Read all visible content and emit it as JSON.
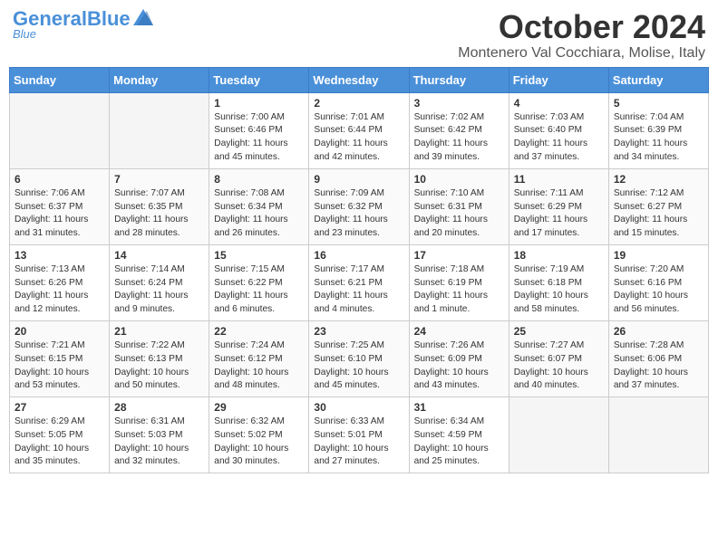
{
  "header": {
    "logo_general": "General",
    "logo_blue": "Blue",
    "month": "October 2024",
    "location": "Montenero Val Cocchiara, Molise, Italy"
  },
  "days_of_week": [
    "Sunday",
    "Monday",
    "Tuesday",
    "Wednesday",
    "Thursday",
    "Friday",
    "Saturday"
  ],
  "weeks": [
    [
      {
        "day": "",
        "info": ""
      },
      {
        "day": "",
        "info": ""
      },
      {
        "day": "1",
        "info": "Sunrise: 7:00 AM\nSunset: 6:46 PM\nDaylight: 11 hours and 45 minutes."
      },
      {
        "day": "2",
        "info": "Sunrise: 7:01 AM\nSunset: 6:44 PM\nDaylight: 11 hours and 42 minutes."
      },
      {
        "day": "3",
        "info": "Sunrise: 7:02 AM\nSunset: 6:42 PM\nDaylight: 11 hours and 39 minutes."
      },
      {
        "day": "4",
        "info": "Sunrise: 7:03 AM\nSunset: 6:40 PM\nDaylight: 11 hours and 37 minutes."
      },
      {
        "day": "5",
        "info": "Sunrise: 7:04 AM\nSunset: 6:39 PM\nDaylight: 11 hours and 34 minutes."
      }
    ],
    [
      {
        "day": "6",
        "info": "Sunrise: 7:06 AM\nSunset: 6:37 PM\nDaylight: 11 hours and 31 minutes."
      },
      {
        "day": "7",
        "info": "Sunrise: 7:07 AM\nSunset: 6:35 PM\nDaylight: 11 hours and 28 minutes."
      },
      {
        "day": "8",
        "info": "Sunrise: 7:08 AM\nSunset: 6:34 PM\nDaylight: 11 hours and 26 minutes."
      },
      {
        "day": "9",
        "info": "Sunrise: 7:09 AM\nSunset: 6:32 PM\nDaylight: 11 hours and 23 minutes."
      },
      {
        "day": "10",
        "info": "Sunrise: 7:10 AM\nSunset: 6:31 PM\nDaylight: 11 hours and 20 minutes."
      },
      {
        "day": "11",
        "info": "Sunrise: 7:11 AM\nSunset: 6:29 PM\nDaylight: 11 hours and 17 minutes."
      },
      {
        "day": "12",
        "info": "Sunrise: 7:12 AM\nSunset: 6:27 PM\nDaylight: 11 hours and 15 minutes."
      }
    ],
    [
      {
        "day": "13",
        "info": "Sunrise: 7:13 AM\nSunset: 6:26 PM\nDaylight: 11 hours and 12 minutes."
      },
      {
        "day": "14",
        "info": "Sunrise: 7:14 AM\nSunset: 6:24 PM\nDaylight: 11 hours and 9 minutes."
      },
      {
        "day": "15",
        "info": "Sunrise: 7:15 AM\nSunset: 6:22 PM\nDaylight: 11 hours and 6 minutes."
      },
      {
        "day": "16",
        "info": "Sunrise: 7:17 AM\nSunset: 6:21 PM\nDaylight: 11 hours and 4 minutes."
      },
      {
        "day": "17",
        "info": "Sunrise: 7:18 AM\nSunset: 6:19 PM\nDaylight: 11 hours and 1 minute."
      },
      {
        "day": "18",
        "info": "Sunrise: 7:19 AM\nSunset: 6:18 PM\nDaylight: 10 hours and 58 minutes."
      },
      {
        "day": "19",
        "info": "Sunrise: 7:20 AM\nSunset: 6:16 PM\nDaylight: 10 hours and 56 minutes."
      }
    ],
    [
      {
        "day": "20",
        "info": "Sunrise: 7:21 AM\nSunset: 6:15 PM\nDaylight: 10 hours and 53 minutes."
      },
      {
        "day": "21",
        "info": "Sunrise: 7:22 AM\nSunset: 6:13 PM\nDaylight: 10 hours and 50 minutes."
      },
      {
        "day": "22",
        "info": "Sunrise: 7:24 AM\nSunset: 6:12 PM\nDaylight: 10 hours and 48 minutes."
      },
      {
        "day": "23",
        "info": "Sunrise: 7:25 AM\nSunset: 6:10 PM\nDaylight: 10 hours and 45 minutes."
      },
      {
        "day": "24",
        "info": "Sunrise: 7:26 AM\nSunset: 6:09 PM\nDaylight: 10 hours and 43 minutes."
      },
      {
        "day": "25",
        "info": "Sunrise: 7:27 AM\nSunset: 6:07 PM\nDaylight: 10 hours and 40 minutes."
      },
      {
        "day": "26",
        "info": "Sunrise: 7:28 AM\nSunset: 6:06 PM\nDaylight: 10 hours and 37 minutes."
      }
    ],
    [
      {
        "day": "27",
        "info": "Sunrise: 6:29 AM\nSunset: 5:05 PM\nDaylight: 10 hours and 35 minutes."
      },
      {
        "day": "28",
        "info": "Sunrise: 6:31 AM\nSunset: 5:03 PM\nDaylight: 10 hours and 32 minutes."
      },
      {
        "day": "29",
        "info": "Sunrise: 6:32 AM\nSunset: 5:02 PM\nDaylight: 10 hours and 30 minutes."
      },
      {
        "day": "30",
        "info": "Sunrise: 6:33 AM\nSunset: 5:01 PM\nDaylight: 10 hours and 27 minutes."
      },
      {
        "day": "31",
        "info": "Sunrise: 6:34 AM\nSunset: 4:59 PM\nDaylight: 10 hours and 25 minutes."
      },
      {
        "day": "",
        "info": ""
      },
      {
        "day": "",
        "info": ""
      }
    ]
  ]
}
